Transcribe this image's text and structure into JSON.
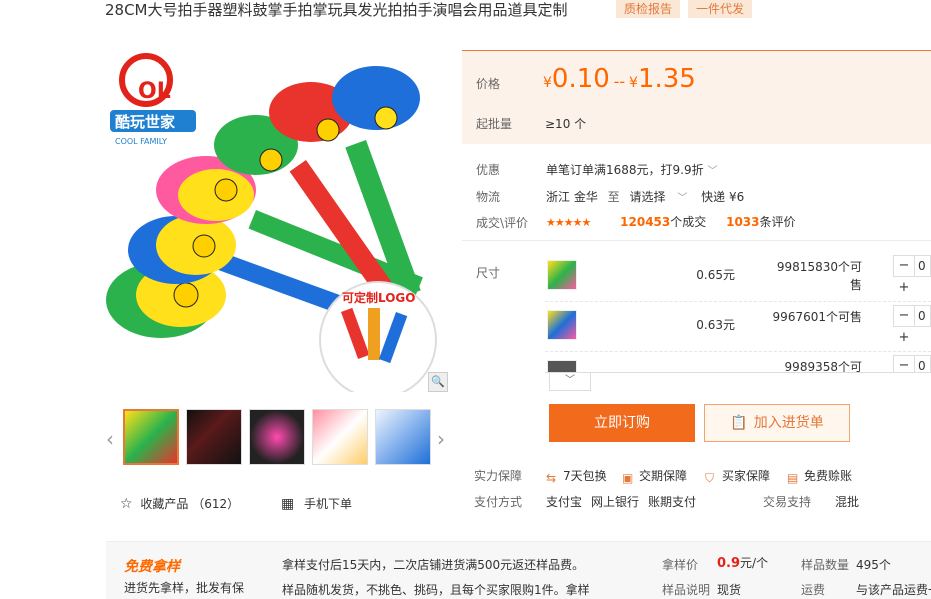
{
  "title": "28CM大号拍手器塑料鼓掌手拍掌玩具发光拍拍手演唱会用品道具定制",
  "tags": [
    "质检报告",
    "一件代发"
  ],
  "brand": {
    "name_cn": "酷玩世家",
    "name_en": "COOL FAMILY"
  },
  "banner_text": "可定制LOGO",
  "gallery": {
    "favorite_label": "收藏产品",
    "favorite_count": "（612）",
    "mobile_label": "手机下单"
  },
  "price": {
    "label": "价格",
    "currency": "¥",
    "min": "0.10",
    "range_sep": "--",
    "max": "1.35"
  },
  "moq": {
    "label": "起批量",
    "value": "≥10 个"
  },
  "promo": {
    "label": "优惠",
    "value": "单笔订单满1688元，打9.9折"
  },
  "logistics": {
    "label": "物流",
    "origin": "浙江 金华",
    "to": "至",
    "dest": "请选择",
    "shipping": "快递 ¥6"
  },
  "deals": {
    "label": "成交\\评价",
    "orders_count": "120453",
    "orders_suffix": "个成交",
    "reviews_count": "1033",
    "reviews_suffix": "条评价",
    "rating": 4.5
  },
  "sku": {
    "label": "尺寸",
    "rows": [
      {
        "price": "0.65元",
        "stock": "99815830个可售",
        "qty": "0"
      },
      {
        "price": "0.63元",
        "stock": "9967601个可售",
        "qty": "0"
      },
      {
        "price": "",
        "stock": "9989358个可",
        "qty": "0"
      }
    ]
  },
  "buttons": {
    "buy": "立即订购",
    "cart": "加入进货单"
  },
  "guarantee": {
    "label": "实力保障",
    "items": [
      "7天包换",
      "交期保障",
      "买家保障",
      "免费赊账"
    ]
  },
  "payment": {
    "label": "支付方式",
    "methods": [
      "支付宝",
      "网上银行",
      "账期支付"
    ],
    "trade_label": "交易支持",
    "trade_value": "混批"
  },
  "sample": {
    "title": "免费拿样",
    "subtitle": "进货先拿样，批发有保",
    "line1": "拿样支付后15天内，二次店铺进货满500元返还样品费。",
    "line2": "样品随机发货，不挑色、挑码，且每个买家限购1件。拿样",
    "price_label": "拿样价",
    "price_value": "0.9",
    "price_unit": "元/个",
    "count_label": "样品数量",
    "count_value": "495个",
    "desc_label": "样品说明",
    "desc_value": "现货",
    "freight_label": "运费",
    "freight_value": "与该产品运费一"
  },
  "colors": {
    "accent": "#ff6600",
    "tag_bg": "#fbe7d6",
    "price_bg": "#fdf2ea",
    "buy_btn": "#f26a1b"
  }
}
